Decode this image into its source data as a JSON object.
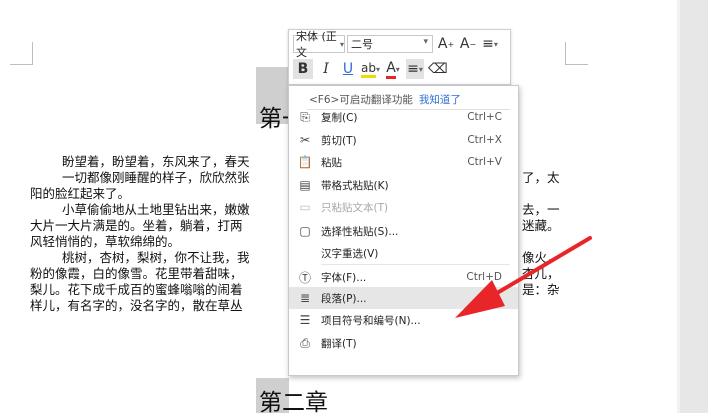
{
  "document": {
    "heading1_visible": "第一",
    "heading2": "第二章",
    "lines": [
      {
        "text": "盼望着，盼望着，东风来了，春天",
        "indent": true
      },
      {
        "text": "一切都像刚睡醒的样子，欣欣然张",
        "indent": true,
        "tail": "了，太"
      },
      {
        "text": "阳的脸红起来了。",
        "indent": false
      },
      {
        "text": "小草偷偷地从土地里钻出来，嫩嫩",
        "indent": true,
        "tail": "去，一"
      },
      {
        "text": "大片一大片满是的。坐着，躺着，打两",
        "indent": false,
        "tail": "迷藏。"
      },
      {
        "text": "风轻悄悄的，草软绵绵的。",
        "indent": false
      },
      {
        "text": "桃树，杏树，梨树，你不让我，我",
        "indent": true,
        "tail": "像火，"
      },
      {
        "text": "粉的像霞，白的像雪。花里带着甜味，",
        "indent": false,
        "tail": "杏儿，"
      },
      {
        "text": "梨儿。花下成千成百的蜜蜂嗡嗡的闹着",
        "indent": false,
        "tail": "是：杂"
      },
      {
        "text": "样儿，有名字的，没名字的，散在草丛",
        "indent": false
      }
    ]
  },
  "mini_toolbar": {
    "font_name": "宋体 (正文",
    "font_size": "二号",
    "grow_font": "A",
    "shrink_font": "A",
    "bold": "B",
    "italic": "I",
    "underline": "U",
    "highlight": "ab",
    "font_color": "A",
    "align": "≡",
    "line_spacing": "≡",
    "eraser": "⌫"
  },
  "context_menu": {
    "tip": "<F6>可启动翻译功能",
    "tip_link": "我知道了",
    "items": [
      {
        "label": "复制(C)",
        "shortcut": "Ctrl+C",
        "icon": "copy-icon",
        "glyph": "⎘",
        "disabled": false
      },
      {
        "label": "剪切(T)",
        "shortcut": "Ctrl+X",
        "icon": "scissors-icon",
        "glyph": "✂",
        "disabled": false
      },
      {
        "label": "粘贴",
        "shortcut": "Ctrl+V",
        "icon": "paste-icon",
        "glyph": "📋",
        "disabled": false
      },
      {
        "label": "带格式粘贴(K)",
        "shortcut": "",
        "icon": "paste-formatted-icon",
        "glyph": "▤",
        "disabled": false
      },
      {
        "label": "只粘贴文本(T)",
        "shortcut": "",
        "icon": "paste-text-icon",
        "glyph": "▭",
        "disabled": true
      },
      {
        "label": "选择性粘贴(S)...",
        "shortcut": "",
        "icon": "paste-special-icon",
        "glyph": "▢",
        "disabled": false
      },
      {
        "label": "汉字重选(V)",
        "shortcut": "",
        "icon": "",
        "glyph": "",
        "disabled": false
      },
      {
        "label": "字体(F)...",
        "shortcut": "Ctrl+D",
        "icon": "font-icon",
        "glyph": "Ⓣ",
        "disabled": false
      },
      {
        "label": "段落(P)...",
        "shortcut": "",
        "icon": "paragraph-icon",
        "glyph": "≣",
        "disabled": false,
        "hover": true
      },
      {
        "label": "项目符号和编号(N)...",
        "shortcut": "",
        "icon": "bullets-icon",
        "glyph": "☰",
        "disabled": false
      },
      {
        "label": "翻译(T)",
        "shortcut": "",
        "icon": "translate-icon",
        "glyph": "⎙",
        "disabled": false
      }
    ]
  },
  "colors": {
    "highlight_gray": "#cfcfcf",
    "arrow_red": "#e8262a",
    "link_blue": "#2f6fd6",
    "hover_gray": "#e6e6e6"
  }
}
